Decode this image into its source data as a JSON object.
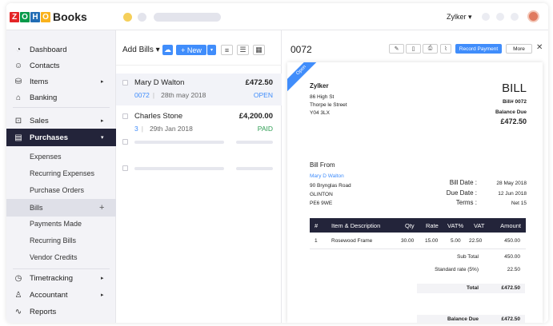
{
  "app": {
    "logo_letters": [
      "Z",
      "O",
      "H",
      "O"
    ],
    "logo_colors": [
      "#e42527",
      "#089949",
      "#226db4",
      "#f9b21d"
    ],
    "logo_text": "Books",
    "org_name": "Zylker ▾"
  },
  "sidebar": {
    "items": [
      {
        "label": "Dashboard",
        "icon": "dashboard-icon",
        "glyph": "◔"
      },
      {
        "label": "Contacts",
        "icon": "contacts-icon",
        "glyph": "☺"
      },
      {
        "label": "Items",
        "icon": "items-icon",
        "glyph": "⛁",
        "chevron": "▸"
      },
      {
        "label": "Banking",
        "icon": "banking-icon",
        "glyph": "⌂"
      },
      {
        "label": "Sales",
        "icon": "sales-icon",
        "glyph": "⊡",
        "chevron": "▸"
      },
      {
        "label": "Purchases",
        "icon": "purchases-icon",
        "glyph": "▤",
        "chevron": "▾"
      }
    ],
    "sub_items": [
      "Expenses",
      "Recurring Expenses",
      "Purchase Orders",
      "Bills",
      "Payments Made",
      "Recurring Bills",
      "Vendor Credits"
    ],
    "bills_plus": "+",
    "bottom_items": [
      {
        "label": "Timetracking",
        "icon": "clock-icon",
        "glyph": "◷",
        "chevron": "▸"
      },
      {
        "label": "Accountant",
        "icon": "accountant-icon",
        "glyph": "♙",
        "chevron": "▸"
      },
      {
        "label": "Reports",
        "icon": "reports-icon",
        "glyph": "∿"
      }
    ]
  },
  "list": {
    "title": "Add Bills ▾",
    "new_label": "+ New",
    "bills": [
      {
        "vendor": "Mary D Walton",
        "amount": "£472.50",
        "number": "0072",
        "date": "28th may 2018",
        "status": "OPEN",
        "status_color": "#408dfb"
      },
      {
        "vendor": "Charles Stone",
        "amount": "£4,200.00",
        "number": "3",
        "date": "29th Jan 2018",
        "status": "PAID",
        "status_color": "#2e9e53"
      }
    ]
  },
  "detail": {
    "title": "0072",
    "record_payment": "Record Payment",
    "more": "More",
    "close": "✕",
    "ribbon": "Open",
    "company": "Zylker",
    "address": [
      "86 High St",
      "Thorpe le Street",
      "Y04 3LX"
    ],
    "doc_type": "BILL",
    "bill_no_label": "Bill# 0072",
    "balance_due_label": "Balance Due",
    "balance_due": "£472.50",
    "bill_from_label": "Bill From",
    "vendor": "Mary D Walton",
    "vendor_address": [
      "90 Brynglas Road",
      "GLINTON",
      "PE6 9WE"
    ],
    "bill_date_label": "Bill Date :",
    "bill_date": "28 May 2018",
    "due_date_label": "Due Date :",
    "due_date": "12 Jun 2018",
    "terms_label": "Terms :",
    "terms": "Net 15",
    "table_headers": [
      "#",
      "Item & Description",
      "Qty",
      "Rate",
      "VAT%",
      "VAT",
      "Amount"
    ],
    "line_items": [
      {
        "n": "1",
        "desc": "Rosewood Frame",
        "qty": "30.00",
        "rate": "15.00",
        "vatp": "5.00",
        "vat": "22.50",
        "amount": "450.00"
      }
    ],
    "sub_total_label": "Sub Total",
    "sub_total": "450.00",
    "std_rate_label": "Standard rate (5%)",
    "std_rate": "22.50",
    "total_label": "Total",
    "total": "£472.50",
    "bal_due_label": "Balance Due",
    "bal_due": "£472.50"
  }
}
